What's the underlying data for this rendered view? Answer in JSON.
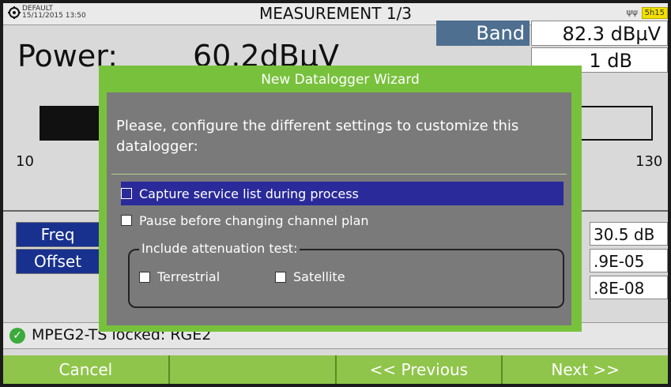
{
  "titlebar": {
    "profile": "DEFAULT",
    "datetime": "15/11/2015 13:50",
    "title": "MEASUREMENT 1/3",
    "battery": "5h15"
  },
  "background": {
    "power_label": "Power:",
    "power_value": "60.2dBµV",
    "scale_min": "10",
    "scale_max": "130",
    "band_label": "Band",
    "band_value": "82.3 dBµV",
    "band_value2": "1 dB",
    "freq_label": "Freq",
    "offset_label": "Offset",
    "right_values": [
      "30.5 dB",
      ".9E-05",
      ".8E-08"
    ],
    "status_text": "MPEG2-TS locked: RGE2"
  },
  "modal": {
    "title": "New Datalogger Wizard",
    "message": "Please, configure the different settings to customize this datalogger:",
    "options": [
      {
        "label": "Capture service list during process",
        "selected": true
      },
      {
        "label": "Pause before changing channel plan",
        "selected": false
      }
    ],
    "attenuation": {
      "legend": "Include attenuation test:",
      "terrestrial": "Terrestrial",
      "satellite": "Satellite"
    }
  },
  "footer": {
    "cancel": "Cancel",
    "empty": "",
    "previous": "<< Previous",
    "next": "Next >>"
  },
  "colors": {
    "accent_green": "#78c13c",
    "softkey_green": "#8fc54a",
    "selection_blue": "#2a2a9a",
    "label_blue": "#18318e"
  }
}
